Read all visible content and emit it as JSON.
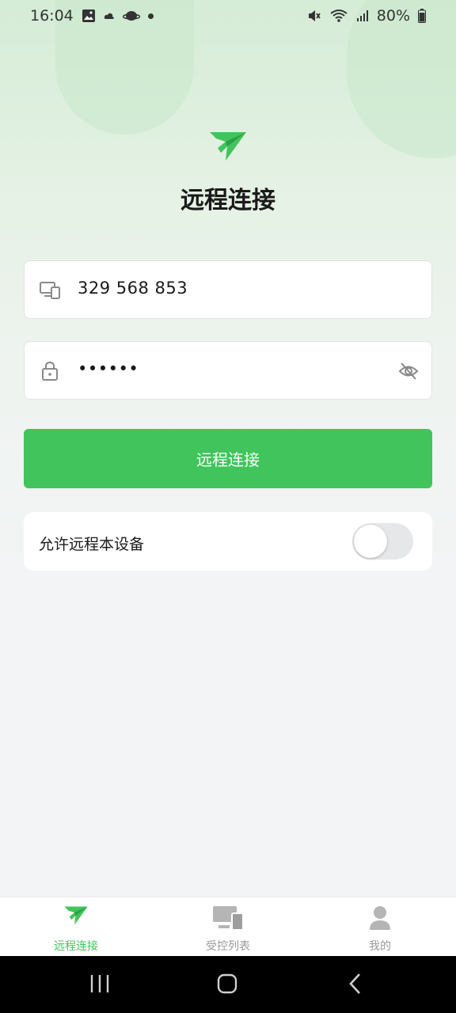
{
  "status_bar": {
    "time": "16:04",
    "battery": "80%"
  },
  "header": {
    "title": "远程连接",
    "logo_icon": "paper-plane-logo"
  },
  "form": {
    "device_id": "329 568 853",
    "password_masked": "••••••",
    "device_icon": "device-icon",
    "lock_icon": "lock-icon",
    "eye_icon": "eye-off-icon"
  },
  "connect_button": {
    "label": "远程连接",
    "color": "#41c45b"
  },
  "allow_remote": {
    "label": "允许远程本设备",
    "enabled": false
  },
  "tabs": [
    {
      "label": "远程连接",
      "icon": "remote-connect-icon",
      "active": true
    },
    {
      "label": "受控列表",
      "icon": "devices-icon",
      "active": false
    },
    {
      "label": "我的",
      "icon": "user-icon",
      "active": false
    }
  ],
  "colors": {
    "accent": "#41c45b",
    "inactive_tab": "#999999"
  }
}
